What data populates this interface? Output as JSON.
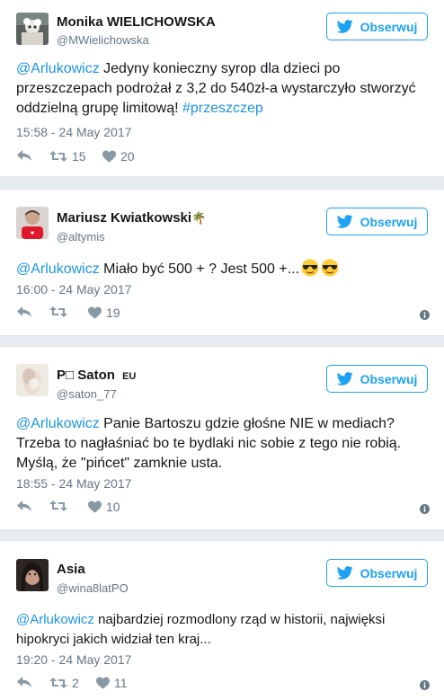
{
  "follow_label": "Obserwuj",
  "accent": "#1da1f2",
  "tweets": [
    {
      "name": "Monika WIELICHOWSKA",
      "handle": "@MWielichowska",
      "mention": "@Arlukowicz",
      "text": " Jedyny konieczny syrop dla dzieci po przeszczepach podrożał z 3,2 do 540zł-a wystarczyło stworzyć oddzielną grupę limitową! ",
      "hashtag": "#przeszczep",
      "date": "15:58 - 24 May 2017",
      "retweets": "15",
      "likes": "20"
    },
    {
      "name": "Mariusz Kwiatkowski",
      "name_suffix": "🌴",
      "handle": "@altymis",
      "mention": "@Arlukowicz",
      "text": " Miało być 500 + ? Jest 500 +...",
      "emoji": [
        "smiling-face-with-sunglasses",
        "smiling-face-with-sunglasses"
      ],
      "date": "16:00 - 24 May 2017",
      "retweets": "",
      "likes": "19"
    },
    {
      "name": "P□ Saton",
      "name_badge": "EU",
      "handle": "@saton_77",
      "mention": "@Arlukowicz",
      "text": " Panie Bartoszu gdzie głośne NIE w mediach? Trzeba to nagłaśniać bo te bydlaki nic sobie z tego nie robią. Myślą, że \"pińcet\" zamknie usta.",
      "date": "18:55 - 24 May 2017",
      "retweets": "",
      "likes": "10"
    },
    {
      "name": "Asia",
      "handle": "@wina8latPO",
      "mention": "@Arlukowicz",
      "text": " najbardziej rozmodlony rząd w historii, najwięksi hipokryci jakich widział ten kraj...",
      "date": "19:20 - 24 May 2017",
      "retweets": "2",
      "likes": "11"
    }
  ]
}
